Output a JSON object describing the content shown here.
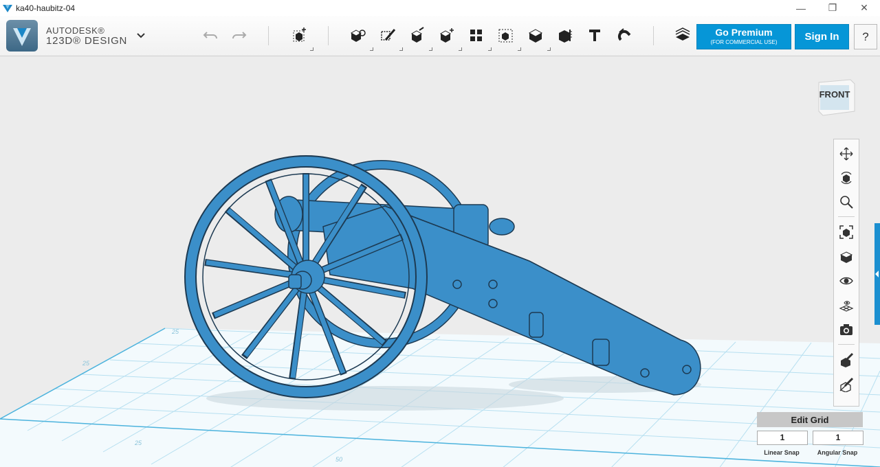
{
  "window": {
    "title": "ka40-haubitz-04",
    "minimize": "—",
    "maximize": "❐",
    "close": "✕"
  },
  "brand": {
    "line1": "AUTODESK®",
    "line2": "123D® DESIGN"
  },
  "toolbar": {
    "tools": [
      "undo-icon",
      "redo-icon",
      "primitives-icon",
      "sketch-icon",
      "construct-icon",
      "modify-icon",
      "pattern-icon",
      "group-icon",
      "combine-icon",
      "measure-icon",
      "text-icon",
      "snap-icon",
      "material-icon"
    ]
  },
  "buttons": {
    "premium_main": "Go Premium",
    "premium_sub": "(FOR COMMERCIAL USE)",
    "signin": "Sign In",
    "help": "?"
  },
  "viewcube": {
    "face": "FRONT"
  },
  "edit_grid": {
    "title": "Edit Grid",
    "linear_value": "1",
    "angular_value": "1",
    "linear_label": "Linear Snap",
    "angular_label": "Angular Snap"
  },
  "grid_labels": [
    "25",
    "25",
    "50",
    "25"
  ],
  "colors": {
    "model": "#3b8fc9",
    "accent": "#0696d7",
    "grid": "#a9d8ec"
  }
}
